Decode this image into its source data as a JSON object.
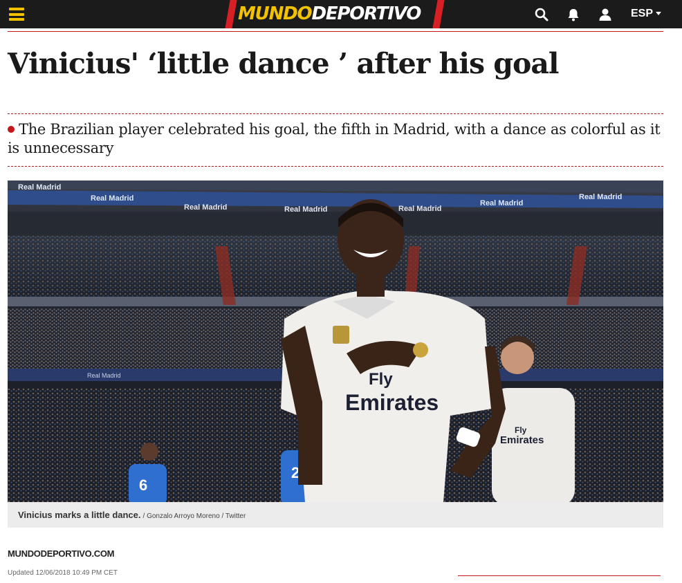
{
  "header": {
    "logo_part1": "MUNDO",
    "logo_part2": "DEPORTIVO",
    "language": "ESP",
    "icons": [
      "menu-icon",
      "search-icon",
      "bell-icon",
      "user-icon"
    ]
  },
  "article": {
    "headline": "Vinicius' ‘little dance ’ after his goal",
    "subtitle": "The Brazilian player celebrated his goal, the fifth in Madrid, with a dance as colorful as it is unnecessary",
    "caption": "Vinicius marks a little dance.",
    "credit": "/ Gonzalo Arroyo Moreno / Twitter",
    "source": "MUNDODEPORTIVO.COM",
    "updated": "Updated 12/06/2018 10:49 PM CET"
  },
  "photo": {
    "banner_texts": [
      "Real Madrid",
      "Real Madrid",
      "Real Madrid",
      "Real Madrid",
      "Real Madrid",
      "Real Madrid",
      "Real Madrid"
    ],
    "shirt_sponsor": [
      "Fly",
      "Emirates"
    ],
    "shirt_sponsor_2": [
      "Fly",
      "Emirates"
    ],
    "player_numbers": [
      "6",
      "2"
    ]
  },
  "colors": {
    "topbar": "#1b1b1b",
    "accent_red": "#c4161c",
    "logo_yellow": "#f2c200"
  }
}
